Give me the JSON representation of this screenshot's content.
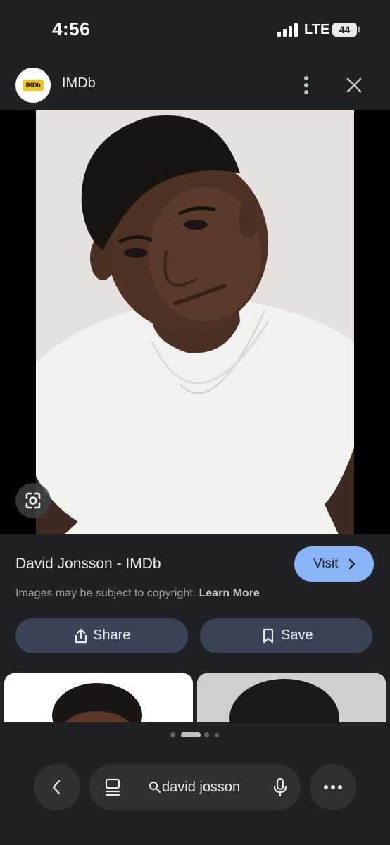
{
  "status_bar": {
    "time": "4:56",
    "network": "LTE",
    "battery": "44"
  },
  "header": {
    "site_name": "IMDb",
    "logo_text": "IMDb",
    "menu_icon": "more-vert-icon",
    "close_icon": "close-icon"
  },
  "result": {
    "title": "David Jonsson - IMDb",
    "visit_label": "Visit",
    "copyright_text": "Images may be subject to copyright.",
    "learn_more_label": "Learn More"
  },
  "actions": {
    "share_label": "Share",
    "save_label": "Save"
  },
  "carousel": {
    "page_count": 4,
    "active_page": 2
  },
  "bottom_bar": {
    "query": "david josson"
  },
  "colors": {
    "background": "#202124",
    "visit_button": "#8ab4f8",
    "action_button": "#394457",
    "imdb_yellow": "#f5c518"
  }
}
